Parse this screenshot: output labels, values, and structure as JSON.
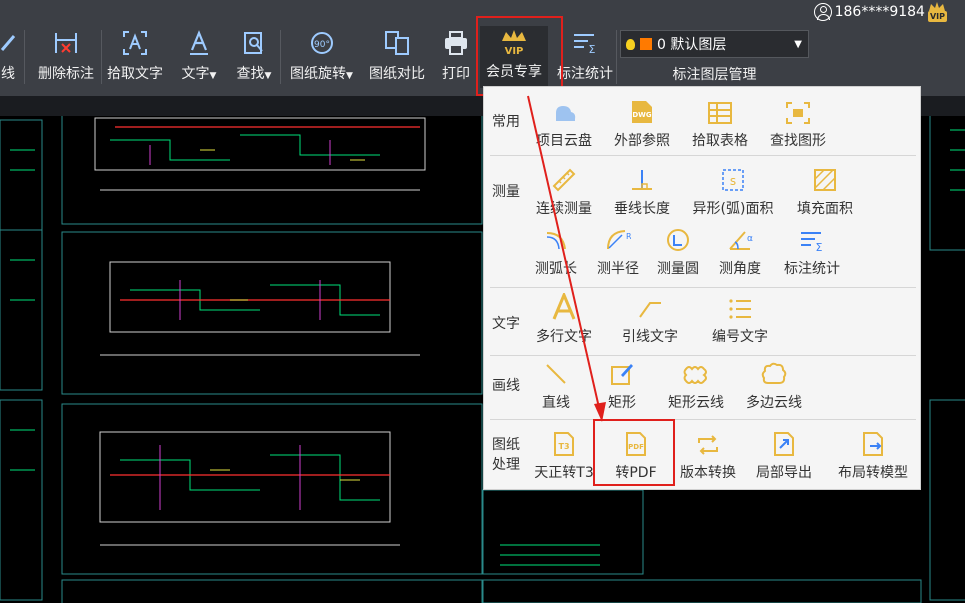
{
  "account": {
    "user": "186****9184",
    "vip_badge": "VIP"
  },
  "toolbar": {
    "items": [
      {
        "label": "画线"
      },
      {
        "label": "删除标注"
      },
      {
        "label": "拾取文字"
      },
      {
        "label": "文字"
      },
      {
        "label": "查找"
      },
      {
        "label": "图纸旋转"
      },
      {
        "label": "图纸对比"
      },
      {
        "label": "打印"
      },
      {
        "label": "会员专享"
      },
      {
        "label": "标注统计"
      }
    ],
    "rotate_icon_text": "90°",
    "vip_icon_text": "VIP"
  },
  "layer": {
    "selected": "0 默认图层",
    "caption": "标注图层管理"
  },
  "menu": {
    "sections": [
      {
        "title": "常用",
        "items": [
          "项目云盘",
          "外部参照",
          "拾取表格",
          "查找图形"
        ]
      },
      {
        "title": "测量",
        "items": [
          "连续测量",
          "垂线长度",
          "异形(弧)面积",
          "填充面积",
          "测弧长",
          "测半径",
          "测量圆",
          "测角度",
          "标注统计"
        ]
      },
      {
        "title": "文字",
        "items": [
          "多行文字",
          "引线文字",
          "编号文字"
        ]
      },
      {
        "title": "画线",
        "items": [
          "直线",
          "矩形",
          "矩形云线",
          "多边云线"
        ]
      },
      {
        "title": "图纸处理",
        "items": [
          "天正转T3",
          "转PDF",
          "版本转换",
          "局部导出",
          "布局转模型"
        ]
      }
    ],
    "icon_texts": {
      "dwg": "DWG",
      "t3": "T3",
      "pdf": "PDF",
      "alpha": "α",
      "sigma": "Σ"
    }
  },
  "colors": {
    "accent": "#e0201c",
    "icon_gold": "#e8b840",
    "toolbar_bg": "#3c3f45",
    "menu_bg": "#f5f5f5",
    "cad_green": "#00e07a"
  }
}
